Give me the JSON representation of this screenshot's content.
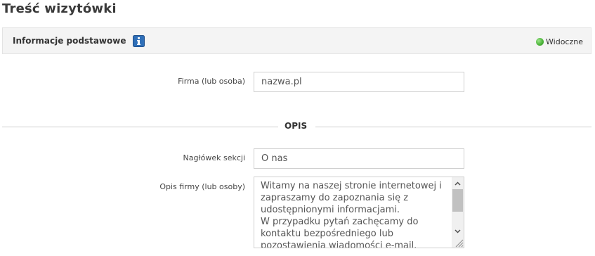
{
  "page": {
    "title": "Treść wizytówki"
  },
  "section": {
    "title": "Informacje podstawowe",
    "info_icon": "info-icon",
    "visibility_label": "Widoczne",
    "visibility_color": "#4fb63c"
  },
  "fields": {
    "company": {
      "label": "Firma (lub osoba)",
      "value": "nazwa.pl"
    },
    "divider_label": "OPIS",
    "section_heading": {
      "label": "Nagłówek sekcji",
      "value": "O nas"
    },
    "description": {
      "label": "Opis firmy (lub osoby)",
      "value": "Witamy na naszej stronie internetowej i\nzapraszamy do zapoznania się z\nudostępnionymi informacjami.\nW przypadku pytań zachęcamy do\nkontaktu bezpośredniego lub\npozostawienia wiadomości e-mail."
    }
  },
  "colors": {
    "info_icon_bg": "#2f6fb8",
    "border": "#cfcfcf",
    "header_bg": "#f4f4f4"
  }
}
